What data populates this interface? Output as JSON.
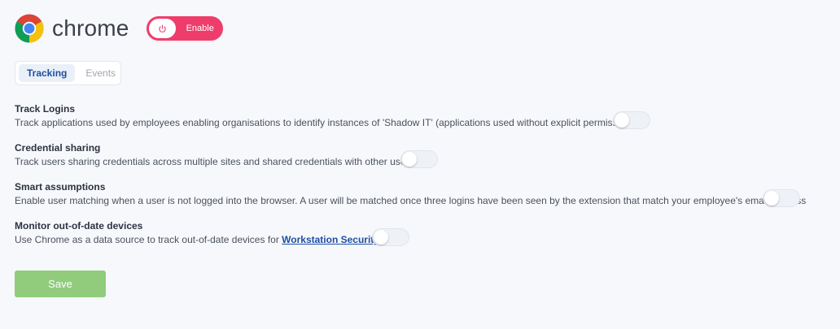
{
  "header": {
    "app_name": "chrome",
    "logo_icon": "chrome-logo-icon",
    "enable_label": "Enable",
    "enable_icon": "power-icon",
    "accent_color": "#ef3d6b"
  },
  "tabs": [
    {
      "label": "Tracking",
      "active": true
    },
    {
      "label": "Events",
      "active": false
    }
  ],
  "settings": [
    {
      "title": "Track Logins",
      "description": "Track applications used by employees enabling organisations to identify instances of 'Shadow IT' (applications used without explicit permission)",
      "enabled": false
    },
    {
      "title": "Credential sharing",
      "description": "Track users sharing credentials across multiple sites and shared credentials with other users",
      "enabled": false
    },
    {
      "title": "Smart assumptions",
      "description": "Enable user matching when a user is not logged into the browser. A user will be matched once three logins have been seen by the extension that match your employee's email address",
      "enabled": false
    },
    {
      "title": "Monitor out-of-date devices",
      "description_prefix": "Use Chrome as a data source to track out-of-date devices for ",
      "link_text": "Workstation Security",
      "enabled": false
    }
  ],
  "save_label": "Save",
  "save_color": "#90cc7c"
}
